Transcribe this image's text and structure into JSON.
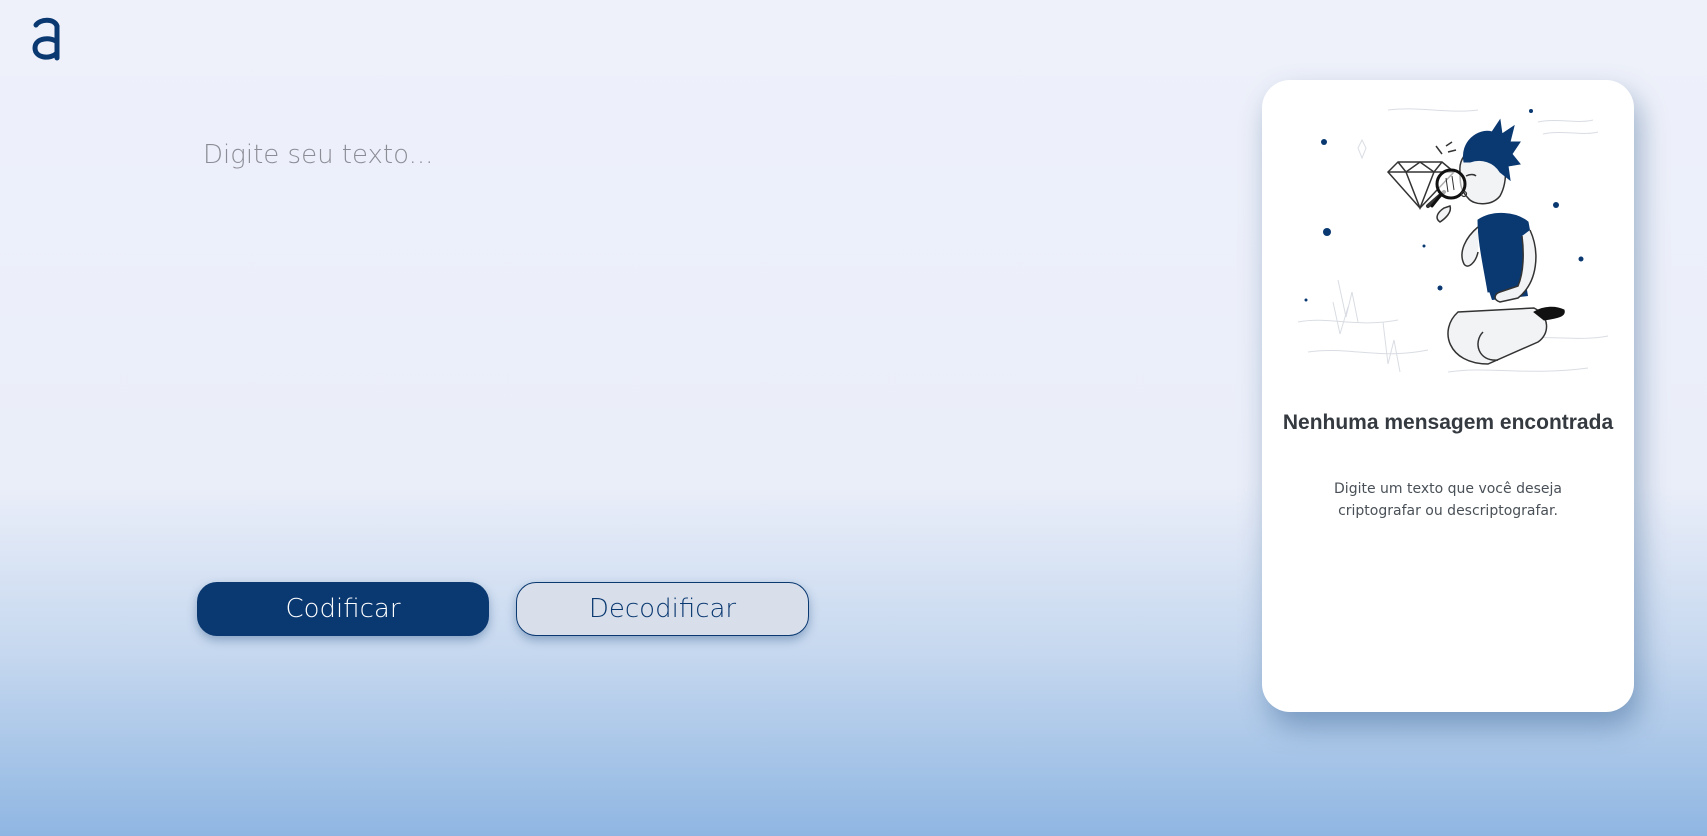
{
  "app": {
    "logo": "alura-logo-icon"
  },
  "editor": {
    "placeholder": "Digite seu texto..."
  },
  "actions": {
    "encode_label": "Codificar",
    "decode_label": "Decodificar"
  },
  "output_panel": {
    "illustration": "person-with-magnifying-glass-illustration",
    "title": "Nenhuma mensagem encontrada",
    "description": "Digite um texto que você deseja criptografar ou descriptografar."
  },
  "colors": {
    "primary": "#0a3871",
    "secondary_button_bg": "#d8dfea",
    "background_top": "#eef1fa",
    "background_bottom": "#8fb6e2",
    "panel_bg": "#ffffff",
    "title_text": "#343a40",
    "body_text": "#495057",
    "placeholder_text": "#8c8c96"
  }
}
